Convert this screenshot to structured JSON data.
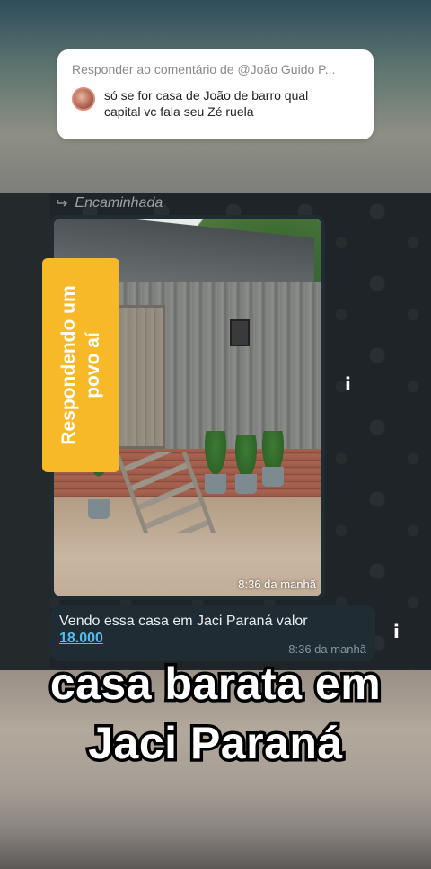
{
  "reply_card": {
    "header": "Responder ao comentário de @João Guido P...",
    "comment_line1": "só se for casa de João de barro qual",
    "comment_line2": "capital vc fala seu Zé ruela"
  },
  "chat": {
    "forwarded_label": "Encaminhada",
    "image_time": "8:36 da manhã",
    "message_text": "Vendo essa casa em Jaci Paraná valor",
    "message_price": "18.000",
    "message_time": "8:36 da manhã",
    "info_icon_glyph": "i"
  },
  "overlay_tag": {
    "line1": "Respondendo um",
    "line2": "povo aí"
  },
  "caption": {
    "line1": "casa barata em",
    "line2": "Jaci Paraná"
  },
  "colors": {
    "tag_yellow": "#f7b928",
    "link_blue": "#53bdeb",
    "bubble_bg": "#1f2c34"
  }
}
